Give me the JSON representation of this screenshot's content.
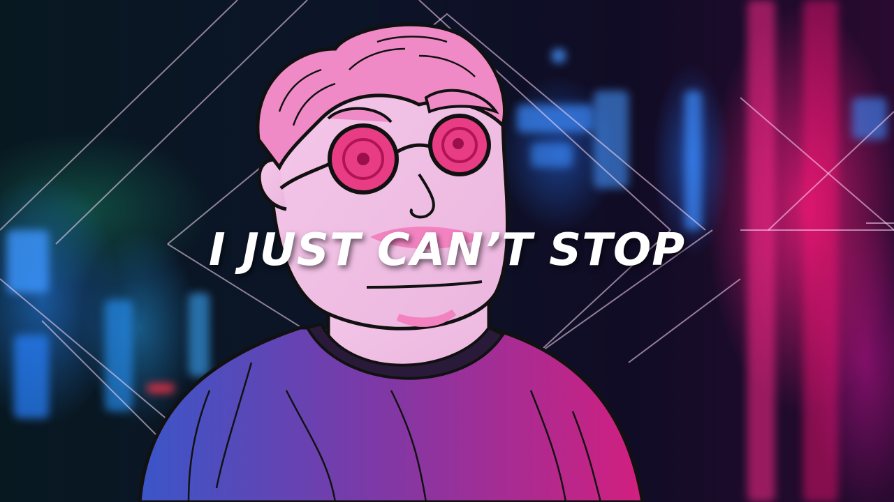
{
  "lyric": {
    "text": "I JUST CAN’T STOP"
  },
  "colors": {
    "text": "#ffffff",
    "neon_pink": "#ff1f8a",
    "neon_blue": "#2f8cff",
    "skin": "#f6c6e6",
    "hair": "#f08ac7",
    "sweater_left": "#3a56c8",
    "sweater_right": "#d21f7f"
  }
}
